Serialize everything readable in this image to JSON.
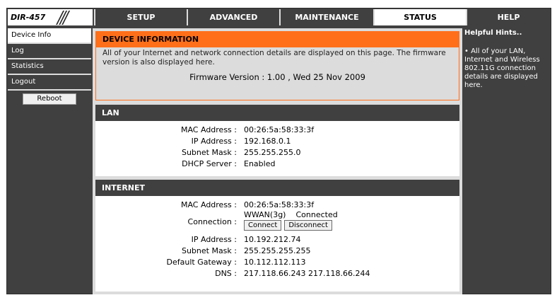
{
  "header": {
    "model": "DIR-457",
    "tabs": [
      "SETUP",
      "ADVANCED",
      "MAINTENANCE",
      "STATUS",
      "HELP"
    ],
    "active_tab": "STATUS"
  },
  "sidebar": {
    "items": [
      {
        "label": "Device Info",
        "active": true
      },
      {
        "label": "Log"
      },
      {
        "label": "Statistics"
      },
      {
        "label": "Logout"
      }
    ],
    "reboot_label": "Reboot"
  },
  "device_info": {
    "title": "DEVICE INFORMATION",
    "description": "All of your Internet and network connection details are displayed on this page. The firmware version is also displayed here.",
    "firmware": "Firmware Version : 1.00 ,  Wed 25 Nov 2009"
  },
  "lan": {
    "title": "LAN",
    "rows": [
      {
        "label": "MAC Address :",
        "value": "00:26:5a:58:33:3f"
      },
      {
        "label": "IP Address :",
        "value": "192.168.0.1"
      },
      {
        "label": "Subnet Mask :",
        "value": "255.255.255.0"
      },
      {
        "label": "DHCP Server :",
        "value": "Enabled"
      }
    ]
  },
  "internet": {
    "title": "INTERNET",
    "mac_label": "MAC Address :",
    "mac_value": "00:26:5a:58:33:3f",
    "connection_label": "Connection :",
    "connection_type": "WWAN(3g)",
    "connection_status": "Connected",
    "connect_label": "Connect",
    "disconnect_label": "Disconnect",
    "rows": [
      {
        "label": "IP Address :",
        "value": "10.192.212.74"
      },
      {
        "label": "Subnet Mask :",
        "value": "255.255.255.255"
      },
      {
        "label": "Default Gateway :",
        "value": "10.112.112.113"
      },
      {
        "label": "DNS :",
        "value": "217.118.66.243 217.118.66.244"
      }
    ]
  },
  "hints": {
    "title": "Helpful Hints..",
    "text": "• All of your LAN, Internet and Wireless 802.11G connection details are displayed here."
  }
}
